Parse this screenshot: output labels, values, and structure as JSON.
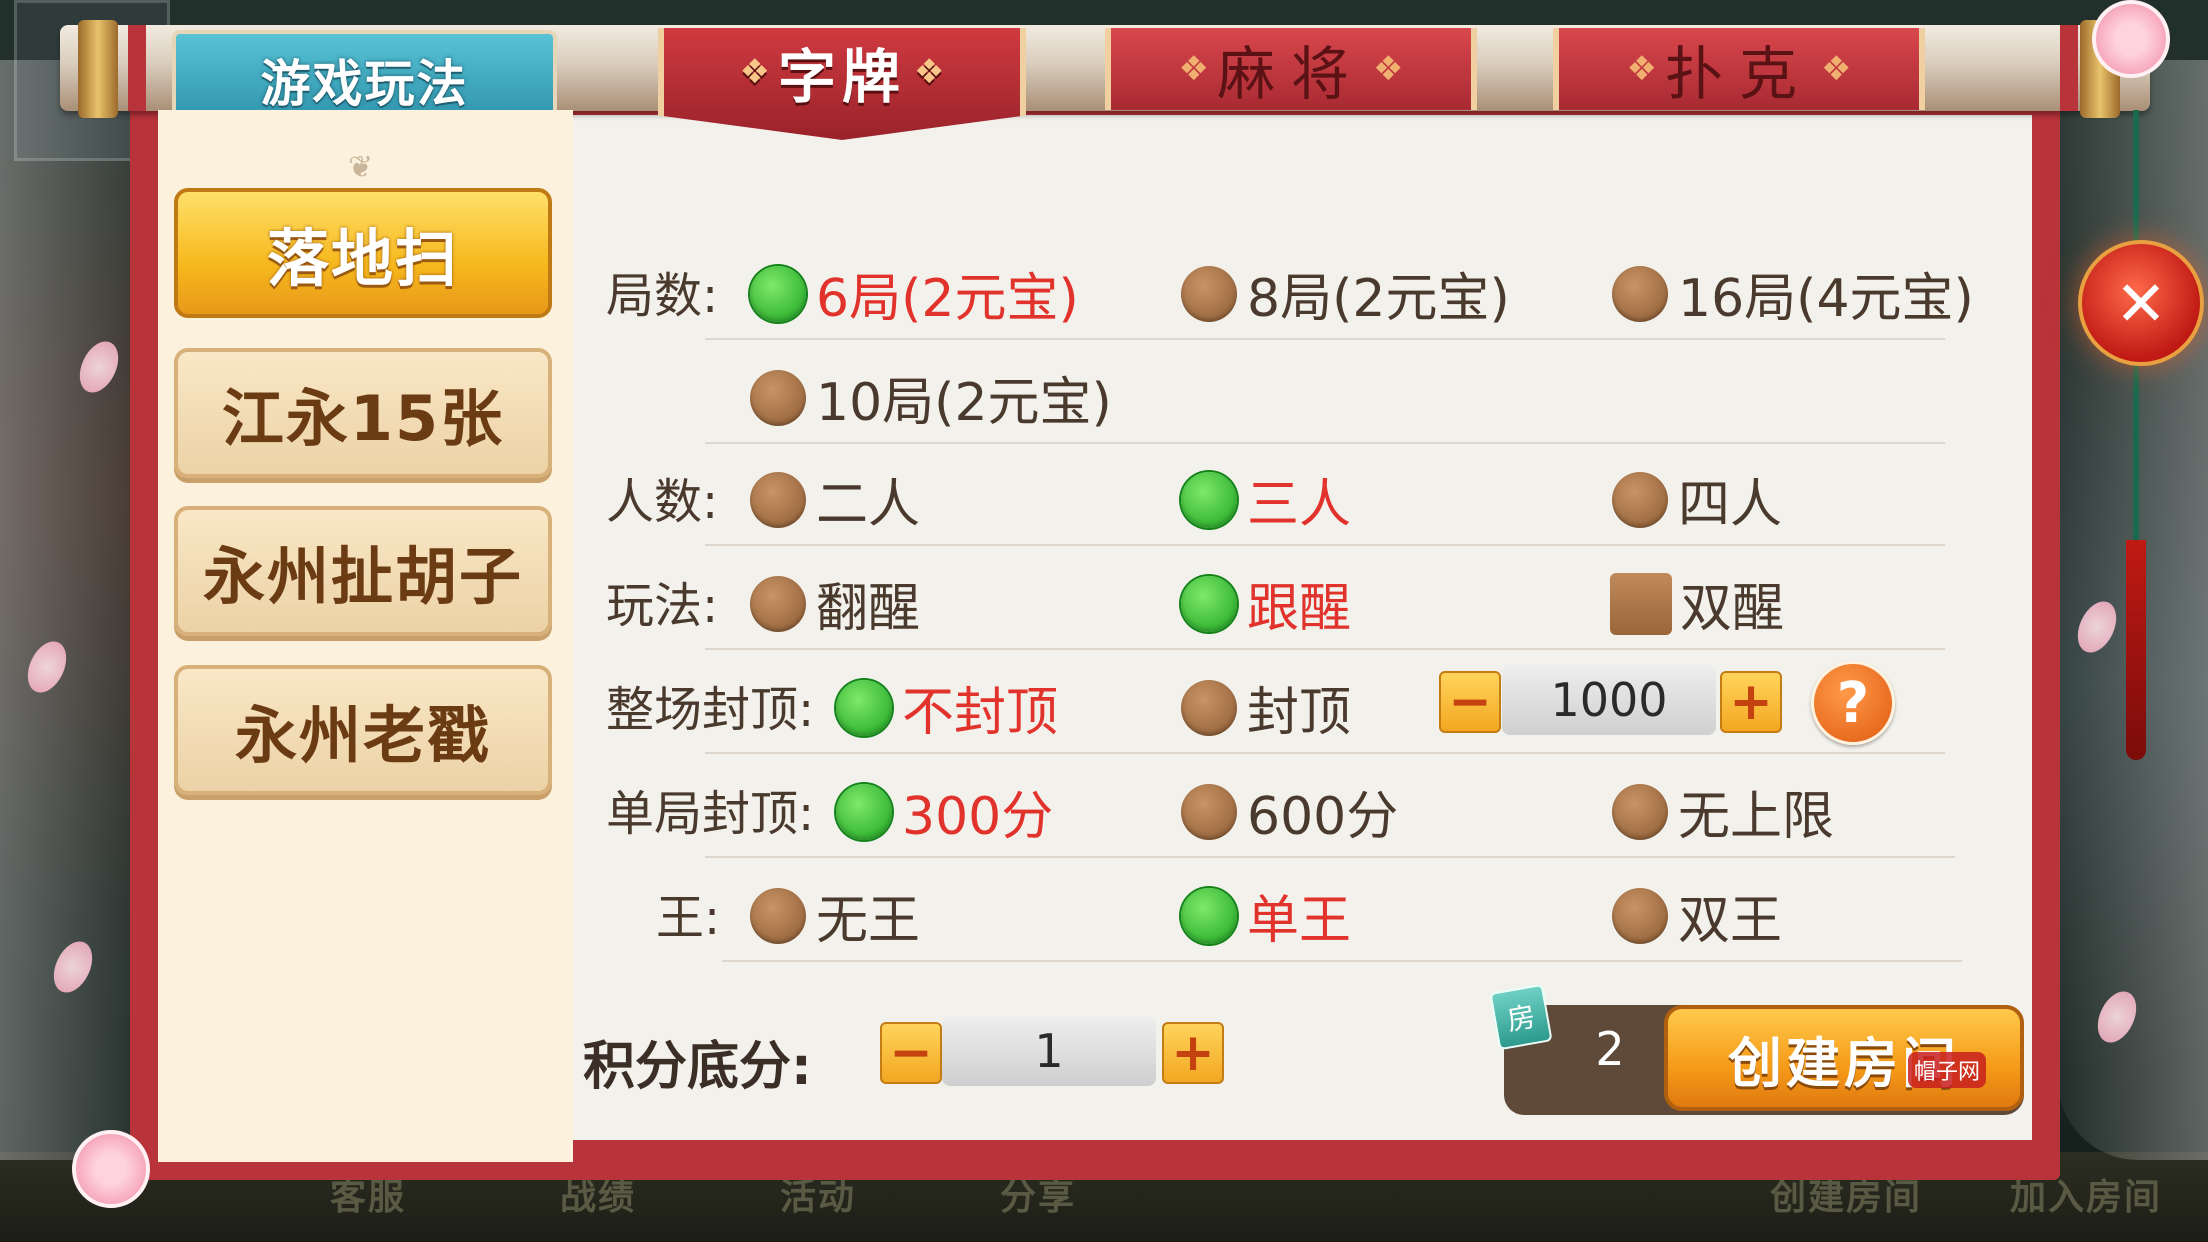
{
  "tabs": {
    "main": "游戏玩法",
    "items": [
      "字牌",
      "麻将",
      "扑克"
    ],
    "active_index": 0
  },
  "sidebar": {
    "items": [
      "落地扫",
      "江永15张",
      "永州扯胡子",
      "永州老戳"
    ],
    "active_index": 0
  },
  "options": {
    "rounds": {
      "label": "局数:",
      "choices": [
        "6局(2元宝)",
        "8局(2元宝)",
        "16局(4元宝)",
        "10局(2元宝)"
      ],
      "selected": "6局(2元宝)"
    },
    "players": {
      "label": "人数:",
      "choices": [
        "二人",
        "三人",
        "四人"
      ],
      "selected": "三人"
    },
    "play_mode": {
      "label": "玩法:",
      "choices": [
        "翻醒",
        "跟醒"
      ],
      "selected": "跟醒",
      "checkbox": {
        "label": "双醒",
        "checked": false
      }
    },
    "match_cap": {
      "label": "整场封顶:",
      "choices": [
        "不封顶",
        "封顶"
      ],
      "selected": "不封顶",
      "stepper": {
        "minus": "−",
        "value": "1000",
        "plus": "+"
      },
      "help": "?"
    },
    "single_cap": {
      "label": "单局封顶:",
      "choices": [
        "300分",
        "600分",
        "无上限"
      ],
      "selected": "300分"
    },
    "king": {
      "label": "王:",
      "choices": [
        "无王",
        "单王",
        "双王"
      ],
      "selected": "单王"
    }
  },
  "base_score": {
    "label": "积分底分:",
    "minus": "−",
    "value": "1",
    "plus": "+"
  },
  "room": {
    "icon_text": "房",
    "count": "2",
    "create_label": "创建房间"
  },
  "close": {
    "glyph": "✕"
  },
  "watermark": "帽子网",
  "background_bar": {
    "items": [
      "客服",
      "战绩",
      "活动",
      "分享",
      "创建房间",
      "加入房间"
    ]
  },
  "colors": {
    "selected_text": "#e1332c",
    "radio_on": "#19a21e",
    "radio_off": "#8b5a32",
    "scroll_red": "#b8343a",
    "tab_teal": "#2a8ea7",
    "button_gold": "#f6b81c"
  }
}
